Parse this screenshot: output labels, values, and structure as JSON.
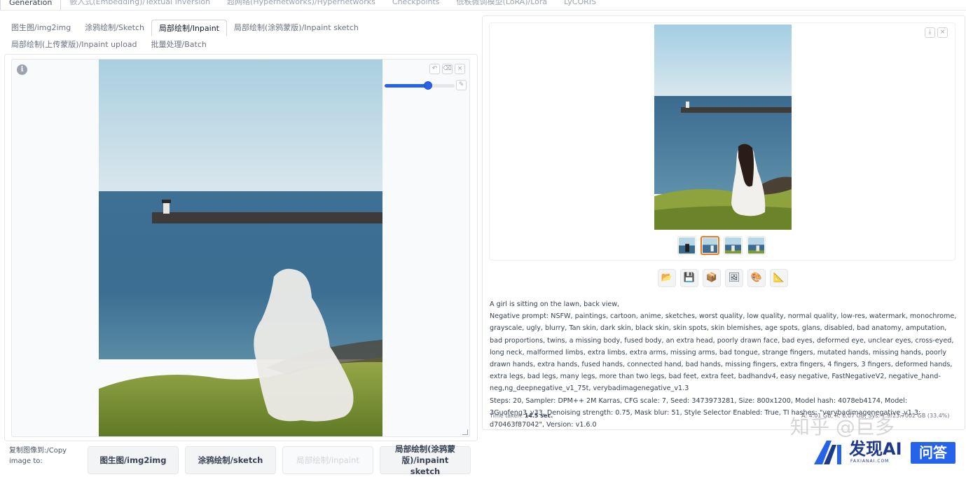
{
  "top_tabs": [
    {
      "label": "Generation",
      "active": true
    },
    {
      "label": "嵌入式(Embedding)/Textual Inversion"
    },
    {
      "label": "超网络(Hypernetworks)/Hypernetworks"
    },
    {
      "label": "Checkpoints"
    },
    {
      "label": "低秩微调模型(LoRA)/Lora"
    },
    {
      "label": "LyCORIS"
    }
  ],
  "sub_tabs_row1": [
    {
      "label": "图生图/img2img"
    },
    {
      "label": "涂鸦绘制/Sketch"
    },
    {
      "label": "局部绘制/Inpaint",
      "active": true
    },
    {
      "label": "局部绘制(涂鸦蒙版)/Inpaint sketch"
    }
  ],
  "sub_tabs_row2": [
    {
      "label": "局部绘制(上传蒙版)/Inpaint upload"
    },
    {
      "label": "批量处理/Batch"
    }
  ],
  "inpaint": {
    "info_icon": "i",
    "brush_size_fraction": 0.62
  },
  "copy": {
    "label": "复制图像到:/Copy image to:",
    "buttons": [
      "图生图/img2img",
      "涂鸦绘制/sketch",
      "局部绘制/inpaint",
      "局部绘制(涂鸦蒙版)/inpaint sketch"
    ]
  },
  "gallery": {
    "selected_thumb": 1,
    "thumb_count": 4
  },
  "actions": [
    "folder-icon",
    "save-icon",
    "zip-icon",
    "send-to-img2img-icon",
    "send-to-inpaint-icon",
    "send-to-extras-icon"
  ],
  "generation_info": {
    "prompt": "A girl is sitting on the lawn, back view,",
    "negative": "Negative prompt: NSFW, paintings, cartoon, anime, sketches, worst quality, low quality, normal quality, low-res, watermark, monochrome, grayscale, ugly, blurry, Tan skin, dark skin, black skin, skin spots, skin blemishes, age spots, glans, disabled, bad anatomy, amputation, bad proportions, twins, a missing body, fused body, an extra head, poorly drawn face, bad eyes, deformed eye, unclear eyes, cross-eyed, long neck, malformed limbs, extra limbs, extra arms, missing arms, bad tongue, strange fingers, mutated hands, missing hands, poorly drawn hands, extra hands, fused hands, connected hand, bad hands, missing fingers, extra fingers, 4 fingers, 3 fingers, deformed hands, extra legs, bad legs, many legs, more than two legs, bad feet, extra feet, badhandv4, easy negative, FastNegativeV2, negative_hand-neg,ng_deepnegative_v1_75t, verybadimagenegative_v1.3",
    "params": "Steps: 20, Sampler: DPM++ 2M Karras, CFG scale: 7, Seed: 3473973281, Size: 800x1200, Model hash: 4078eb4174, Model: 3Guofeng3_v33, Denoising strength: 0.75, Mask blur: 51, Style Selector Enabled: True, TI hashes: \"verybadimagenegative_v1.3: d70463f87042\", Version: v1.6.0",
    "time_label": "Time taken:",
    "time_value": "14.5 sec.",
    "memory": "A: 4.01 GB, R: 6.07 GB, Sys: 7.9/23.7002 GB (33.4%)"
  },
  "watermark": {
    "zhihu": "知乎 @巨多",
    "brand": "发现AI",
    "brand_sub": "FAXIANAI.COM",
    "qa": "问答"
  }
}
